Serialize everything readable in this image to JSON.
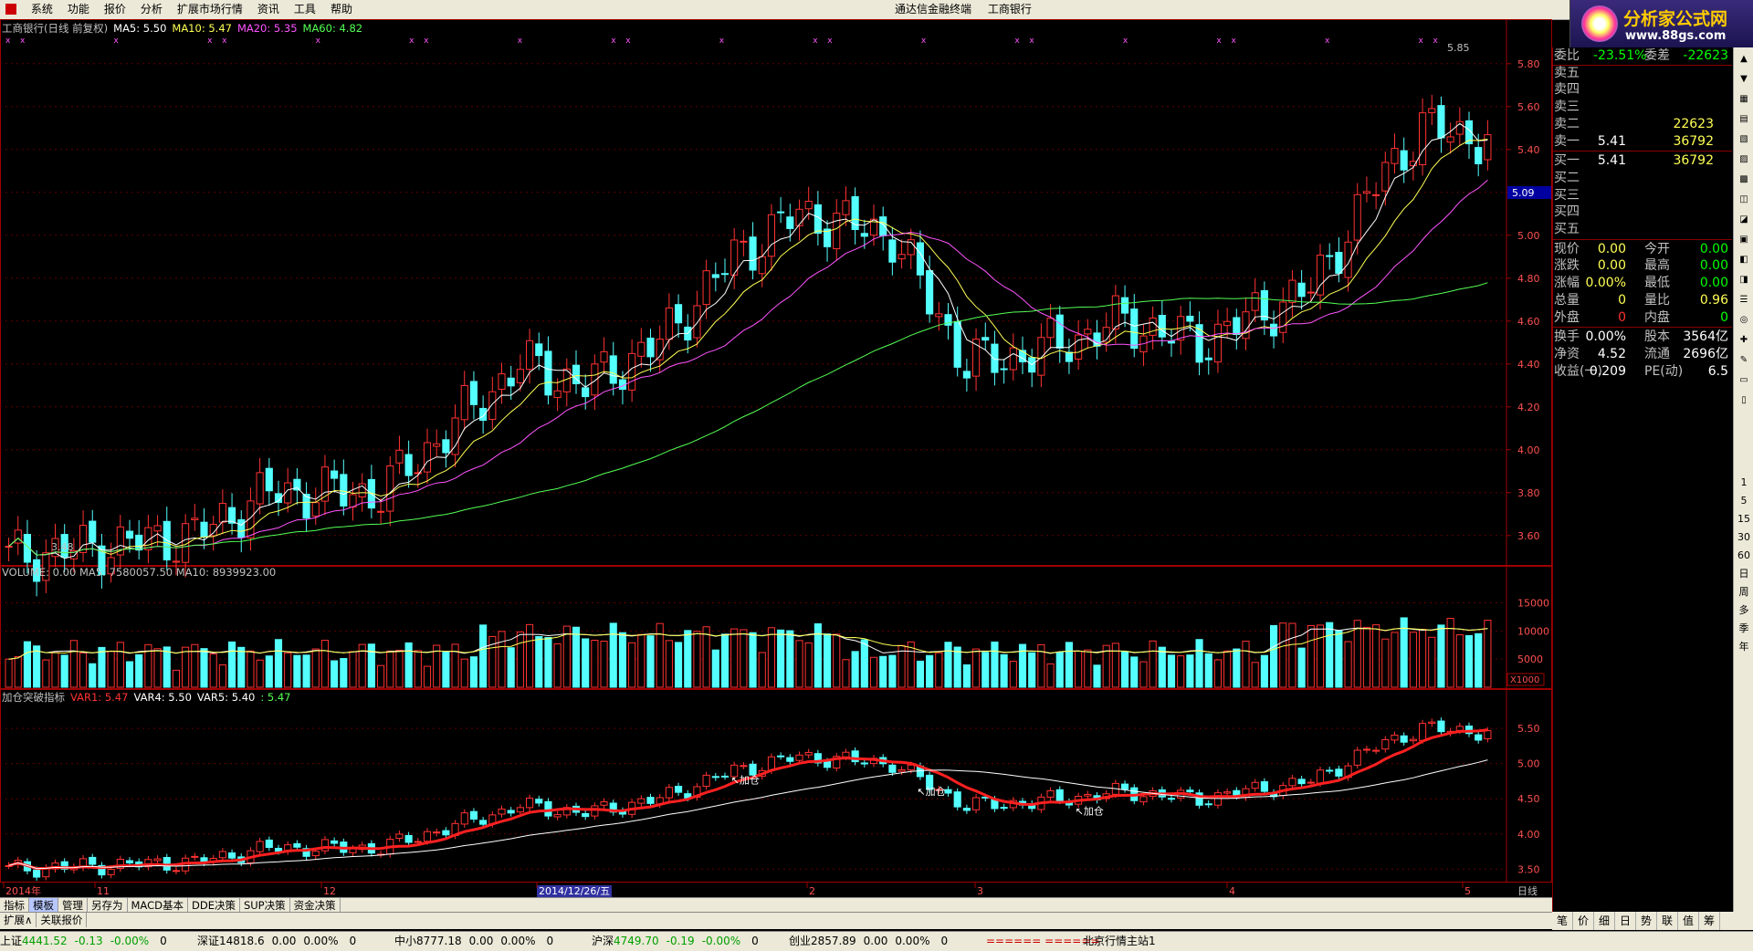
{
  "menu": {
    "items": [
      "系统",
      "功能",
      "报价",
      "分析",
      "扩展市场行情",
      "资讯",
      "工具",
      "帮助"
    ],
    "title_left": "通达信金融终端",
    "title_right": "工商银行"
  },
  "watermark": {
    "text": "分析家公式网",
    "url": "www.88gs.com"
  },
  "price_pane": {
    "title": "工商银行(日线 前复权)",
    "ma": [
      {
        "label": "MA5: 5.50",
        "color": "#ffffff"
      },
      {
        "label": "MA10: 5.47",
        "color": "#ffff54"
      },
      {
        "label": "MA20: 5.35",
        "color": "#ff54ff"
      },
      {
        "label": "MA60: 4.82",
        "color": "#54ff54"
      }
    ],
    "yticks": [
      "5.80",
      "5.60",
      "5.40",
      "5.20",
      "5.00",
      "4.80",
      "4.60",
      "4.40",
      "4.20",
      "4.00",
      "3.80",
      "3.60"
    ],
    "high_label": "5.85",
    "low_label": "3.48",
    "cursor_price": "5.09"
  },
  "volume_pane": {
    "title": "VOLUME: 0.00  MA5: 7580057.50  MA10: 8939923.00",
    "yticks": [
      "15000",
      "10000",
      "5000"
    ],
    "unit": "X1000"
  },
  "indicator_pane": {
    "title": "加仓突破指标",
    "vars": [
      {
        "label": "VAR1: 5.47",
        "color": "#ff3232"
      },
      {
        "label": "VAR4: 5.50",
        "color": "#ffffff"
      },
      {
        "label": "VAR5: 5.40",
        "color": "#ffffff"
      },
      {
        "label": ": 5.47",
        "color": "#54ff54"
      }
    ],
    "yticks": [
      "5.50",
      "5.00",
      "4.50",
      "4.00",
      "3.50"
    ],
    "signal_label": "加仓"
  },
  "xaxis": {
    "labels": [
      "2014年",
      "11",
      "12",
      "2014/12/26/五",
      "2",
      "3",
      "4",
      "5"
    ],
    "period": "日线"
  },
  "quote": {
    "webi": {
      "label": "委比",
      "pct": "-23.51%",
      "label2": "委差",
      "val": "-22623"
    },
    "sell": [
      {
        "l": "卖五",
        "p": "",
        "v": ""
      },
      {
        "l": "卖四",
        "p": "",
        "v": ""
      },
      {
        "l": "卖三",
        "p": "",
        "v": ""
      },
      {
        "l": "卖二",
        "p": "",
        "v": "22623"
      },
      {
        "l": "卖一",
        "p": "5.41",
        "v": "36792"
      }
    ],
    "buy": [
      {
        "l": "买一",
        "p": "5.41",
        "v": "36792"
      },
      {
        "l": "买二",
        "p": "",
        "v": ""
      },
      {
        "l": "买三",
        "p": "",
        "v": ""
      },
      {
        "l": "买四",
        "p": "",
        "v": ""
      },
      {
        "l": "买五",
        "p": "",
        "v": ""
      }
    ],
    "stats": [
      {
        "l": "现价",
        "v": "0.00",
        "l2": "今开",
        "v2": "0.00"
      },
      {
        "l": "涨跌",
        "v": "0.00",
        "l2": "最高",
        "v2": "0.00"
      },
      {
        "l": "涨幅",
        "v": "0.00%",
        "l2": "最低",
        "v2": "0.00"
      },
      {
        "l": "总量",
        "v": "0",
        "l2": "量比",
        "v2": "0.96"
      },
      {
        "l": "外盘",
        "v": "0",
        "l2": "内盘",
        "v2": "0"
      }
    ],
    "stats2": [
      {
        "l": "换手",
        "v": "0.00%",
        "l2": "股本",
        "v2": "3564亿"
      },
      {
        "l": "净资",
        "v": "4.52",
        "l2": "流通",
        "v2": "2696亿"
      },
      {
        "l": "收益(一)",
        "v": "0.209",
        "l2": "PE(动)",
        "v2": "6.5"
      }
    ]
  },
  "tabs": [
    "指标",
    "模板",
    "管理",
    "另存为",
    "MACD基本",
    "DDE决策",
    "SUP决策",
    "资金决策"
  ],
  "tabs2": [
    "扩展∧",
    "关联报价"
  ],
  "bottom_right_tabs": [
    "笔",
    "价",
    "细",
    "日",
    "势",
    "联",
    "值",
    "筹"
  ],
  "status": {
    "indices": [
      {
        "name": "上证",
        "val": "4441.52",
        "chg": "-0.13",
        "pct": "-0.00%",
        "vol": "0"
      },
      {
        "name": "深证",
        "val": "14818.6",
        "chg": "0.00",
        "pct": "0.00%",
        "vol": "0"
      },
      {
        "name": "中小",
        "val": "8777.18",
        "chg": "0.00",
        "pct": "0.00%",
        "vol": "0"
      },
      {
        "name": "沪深",
        "val": "4749.70",
        "chg": "-0.19",
        "pct": "-0.00%",
        "vol": "0"
      },
      {
        "name": "创业",
        "val": "2857.89",
        "chg": "0.00",
        "pct": "0.00%",
        "vol": "0"
      }
    ],
    "ticker": "====== ======",
    "server": "北京行情主站1"
  },
  "right_toolbar": [
    "1",
    "5",
    "15",
    "30",
    "60",
    "日",
    "周",
    "多",
    "季",
    "年"
  ]
}
